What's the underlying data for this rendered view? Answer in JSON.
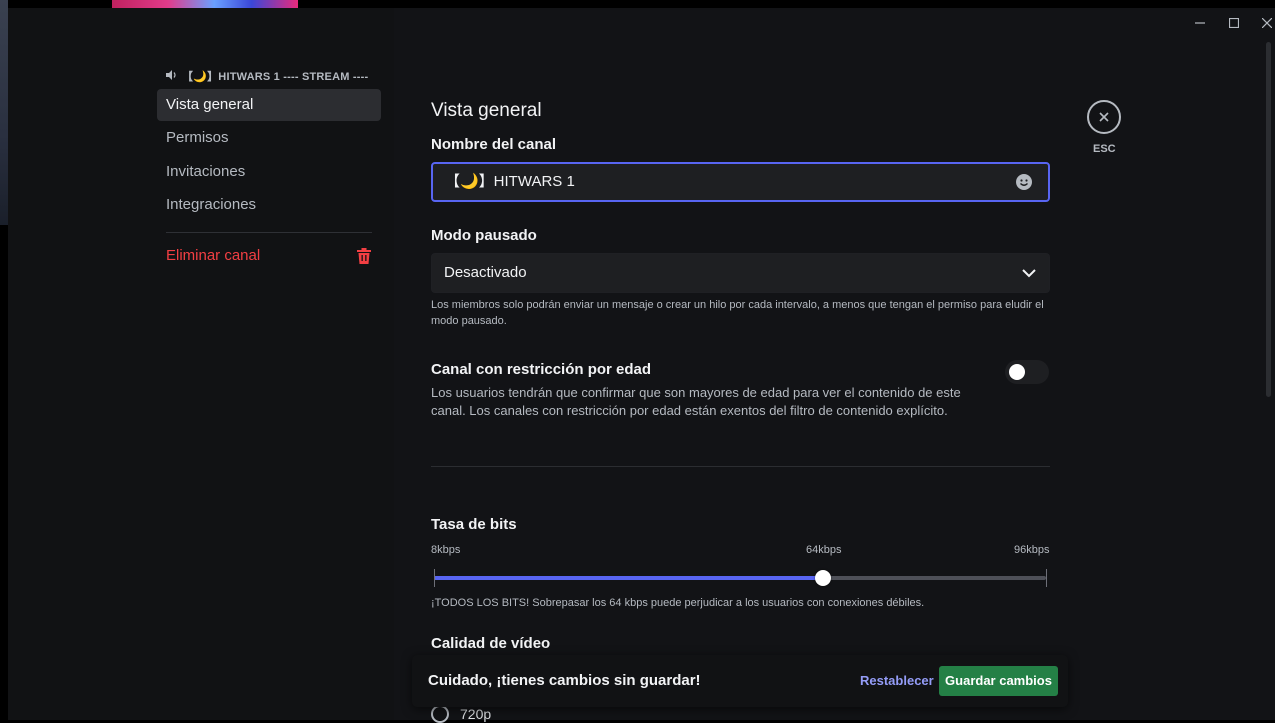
{
  "window": {
    "minimize_icon": "minimize-icon",
    "maximize_icon": "maximize-icon",
    "close_icon": "window-close-icon"
  },
  "sidebar": {
    "channel_header": "【🌙】HITWARS 1 ---- STREAM ----",
    "items": [
      {
        "label": "Vista general",
        "active": true
      },
      {
        "label": "Permisos"
      },
      {
        "label": "Invitaciones"
      },
      {
        "label": "Integraciones"
      }
    ],
    "delete_label": "Eliminar canal"
  },
  "main": {
    "title": "Vista general",
    "channel_name_label": "Nombre del canal",
    "channel_name_value": "【🌙】HITWARS 1",
    "slowmode_label": "Modo pausado",
    "slowmode_value": "Desactivado",
    "slowmode_help_1": "Los miembros solo podrán enviar un mensaje o crear un hilo por cada intervalo, a menos que tengan el permiso para eludir el",
    "slowmode_help_2": "modo pausado.",
    "age_label": "Canal con restricción por edad",
    "age_desc": "Los usuarios tendrán que confirmar que son mayores de edad para ver el contenido de este canal. Los canales con restricción por edad están exentos del filtro de contenido explícito.",
    "age_enabled": false,
    "bitrate_label": "Tasa de bits",
    "bitrate_min": "8kbps",
    "bitrate_mid": "64kbps",
    "bitrate_max": "96kbps",
    "bitrate_value_kbps": 64,
    "bitrate_warning": "¡TODOS LOS BITS! Sobrepasar los 64 kbps puede perjudicar a los usuarios con conexiones débiles.",
    "video_quality_label": "Calidad de vídeo",
    "video_option": "720p",
    "esc_label": "ESC"
  },
  "notice": {
    "text": "Cuidado, ¡tienes cambios sin guardar!",
    "reset_label": "Restablecer",
    "save_label": "Guardar cambios"
  },
  "colors": {
    "accent": "#5865f2",
    "danger": "#f23f43",
    "success": "#248046"
  }
}
